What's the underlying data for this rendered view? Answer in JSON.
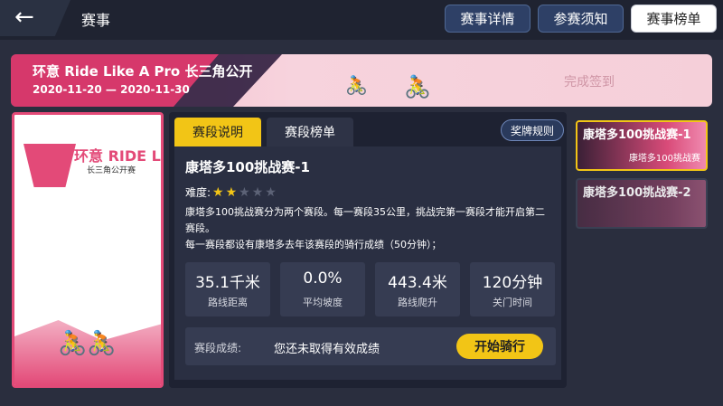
{
  "header": {
    "back_icon": "arrow-left-icon",
    "title": "赛事",
    "tabs": [
      {
        "label": "赛事详情",
        "active": false
      },
      {
        "label": "参赛须知",
        "active": false
      },
      {
        "label": "赛事榜单",
        "active": true
      }
    ]
  },
  "banner": {
    "title": "环意 Ride Like A Pro 长三角公开",
    "date": "2020-11-20 — 2020-11-30",
    "status": "完成签到"
  },
  "poster": {
    "title": "环意 RIDE LIKE A PRO",
    "subtitle": "长三角公开赛"
  },
  "panel": {
    "tabs": [
      {
        "label": "赛段说明",
        "active": true
      },
      {
        "label": "赛段榜单",
        "active": false
      }
    ],
    "medal_rules_label": "奖牌规则",
    "segment_name": "康塔多100挑战赛-1",
    "difficulty_label": "难度:",
    "difficulty": 2,
    "difficulty_max": 5,
    "description": "康塔多100挑战赛分为两个赛段。每一赛段35公里，挑战完第一赛段才能开启第二赛段。\n每一赛段都设有康塔多去年该赛段的骑行成绩（50分钟）；",
    "stats": [
      {
        "value": "35.1千米",
        "label": "路线距离"
      },
      {
        "value": "0.0%",
        "label": "平均坡度"
      },
      {
        "value": "443.4米",
        "label": "路线爬升"
      },
      {
        "value": "120分钟",
        "label": "关门时间"
      }
    ],
    "result_label": "赛段成绩:",
    "result_value": "您还未取得有效成绩",
    "start_button": "开始骑行"
  },
  "segments": [
    {
      "name": "康塔多100挑战赛-1",
      "badge": "康塔多100挑战赛",
      "selected": true
    },
    {
      "name": "康塔多100挑战赛-2",
      "badge": "",
      "selected": false
    }
  ]
}
